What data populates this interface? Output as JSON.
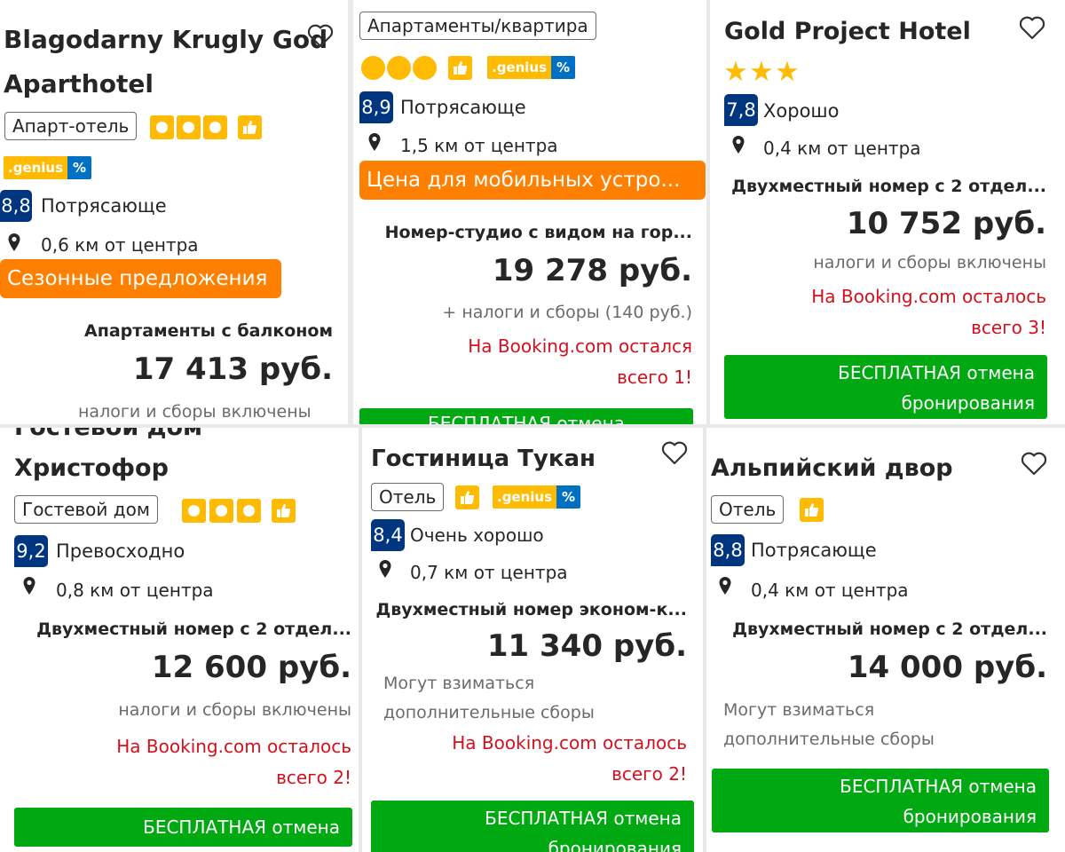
{
  "cards": [
    {
      "title_line1": "Blagodarny Krugly God",
      "title_line2": "Aparthotel",
      "type": "Апарт-отель",
      "genius": ".genius",
      "genius_pct": "%",
      "score": "8,8",
      "rating": "Потрясающе",
      "distance": "0,6 км от центра",
      "promo": "Сезонные предложения",
      "room": "Апартаменты с балконом",
      "price": "17 413 руб.",
      "taxes": "налоги и сборы включены"
    },
    {
      "type": "Апартаменты/квартира",
      "genius": ".genius",
      "genius_pct": "%",
      "score": "8,9",
      "rating": "Потрясающе",
      "distance": "1,5 км от центра",
      "promo": "Цена для мобильных устро...",
      "room": "Номер-студио с видом на гор...",
      "price": "19 278 руб.",
      "taxes": "+ налоги и сборы (140 руб.)",
      "scarcity_line1": "На Booking.com остался",
      "scarcity_line2": "всего 1!",
      "free_cancel": "БЕСПЛАТНАЯ отмена"
    },
    {
      "title_line1": "Gold Project Hotel",
      "score": "7,8",
      "rating": "Хорошо",
      "distance": "0,4 км от центра",
      "room": "Двухместный номер с 2 отдел...",
      "price": "10 752 руб.",
      "taxes": "налоги и сборы включены",
      "scarcity_line1": "На Booking.com осталось",
      "scarcity_line2": "всего 3!",
      "free_cancel_line1": "БЕСПЛАТНАЯ отмена",
      "free_cancel_line2": "бронирования"
    },
    {
      "title_line0": "Гостевой дом",
      "title_line1": "Христофор",
      "type": "Гостевой дом",
      "score": "9,2",
      "rating": "Превосходно",
      "distance": "0,8 км от центра",
      "room": "Двухместный номер с 2 отдел...",
      "price": "12 600 руб.",
      "taxes": "налоги и сборы включены",
      "scarcity_line1": "На Booking.com осталось",
      "scarcity_line2": "всего 2!",
      "free_cancel": "БЕСПЛАТНАЯ отмена"
    },
    {
      "title_line1": "Гостиница Тукан",
      "type": "Отель",
      "genius": ".genius",
      "genius_pct": "%",
      "score": "8,4",
      "rating": "Очень хорошо",
      "distance": "0,7 км от центра",
      "room": "Двухместный номер эконом-к...",
      "price": "11 340 руб.",
      "fees_line1": "Могут взиматься",
      "fees_line2": "дополнительные сборы",
      "scarcity_line1": "На Booking.com осталось",
      "scarcity_line2": "всего 2!",
      "free_cancel_line1": "БЕСПЛАТНАЯ отмена",
      "free_cancel_line2": "бронирования"
    },
    {
      "title_line1": "Альпийский двор",
      "type": "Отель",
      "score": "8,8",
      "rating": "Потрясающе",
      "distance": "0,4 км от центра",
      "room": "Двухместный номер с 2 отдел...",
      "price": "14 000 руб.",
      "fees_line1": "Могут взиматься",
      "fees_line2": "дополнительные сборы",
      "free_cancel_line1": "БЕСПЛАТНАЯ отмена",
      "free_cancel_line2": "бронирования"
    }
  ],
  "colors": {
    "brand_blue": "#003580",
    "genius_yellow": "#febb02",
    "genius_blue": "#0071c2",
    "promo_orange": "#ff8000",
    "scarcity_red": "#d4111e",
    "cancel_green": "#00a812"
  },
  "icons": {
    "heart": "heart-icon",
    "pin": "map-pin-icon",
    "thumb": "thumbs-up-icon",
    "star": "star-icon"
  }
}
